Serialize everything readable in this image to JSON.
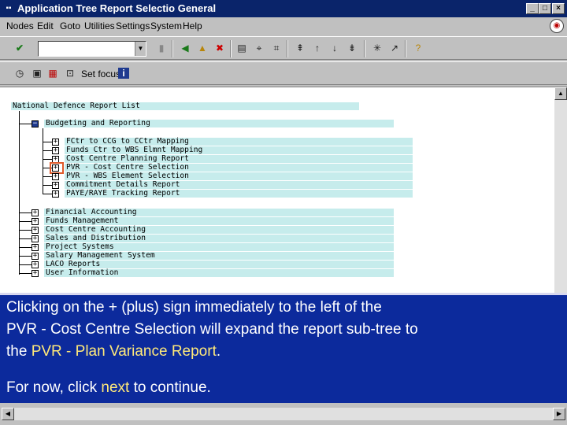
{
  "window": {
    "title": "Application Tree Report Selectio General"
  },
  "menu": [
    "Nodes",
    "Edit",
    "Goto",
    "Utilities",
    "Settings",
    "System",
    "Help"
  ],
  "toolbar2": {
    "set_focus_label": "Set focus"
  },
  "tree": {
    "root": "National Defence Report List",
    "budgeting": "Budgeting and Reporting",
    "budget_children": [
      "FCtr to CCG to CCtr Mapping",
      "Funds Ctr to WBS Elmnt Mapping",
      "Cost Centre Planning Report",
      "PVR - Cost Centre Selection",
      "PVR - WBS Element Selection",
      "Commitment Details Report",
      "PAYE/RAYE Tracking Report"
    ],
    "other_nodes": [
      "Financial Accounting",
      "Funds Management",
      "Cost Centre Accounting",
      "Sales and Distribution",
      "Project Systems",
      "Salary Management System",
      "LACO Reports",
      "User Information"
    ]
  },
  "callout": {
    "line1": "Clicking on the + (plus) sign immediately to the left of the",
    "line2": "PVR - Cost Centre Selection will expand the report sub-tree to",
    "line3_pre": "the ",
    "line3_hl": "PVR - Plan Variance Report",
    "line3_post": ".",
    "line4_pre": "For now, click ",
    "line4_hl": "next",
    "line4_post": " to continue."
  },
  "colors": {
    "titlebar": "#0a246a",
    "node_bg": "#c6ecec",
    "callout_bg": "#0c2a9c",
    "highlight_text": "#ffe97a",
    "selection_box": "#e05a2a"
  }
}
